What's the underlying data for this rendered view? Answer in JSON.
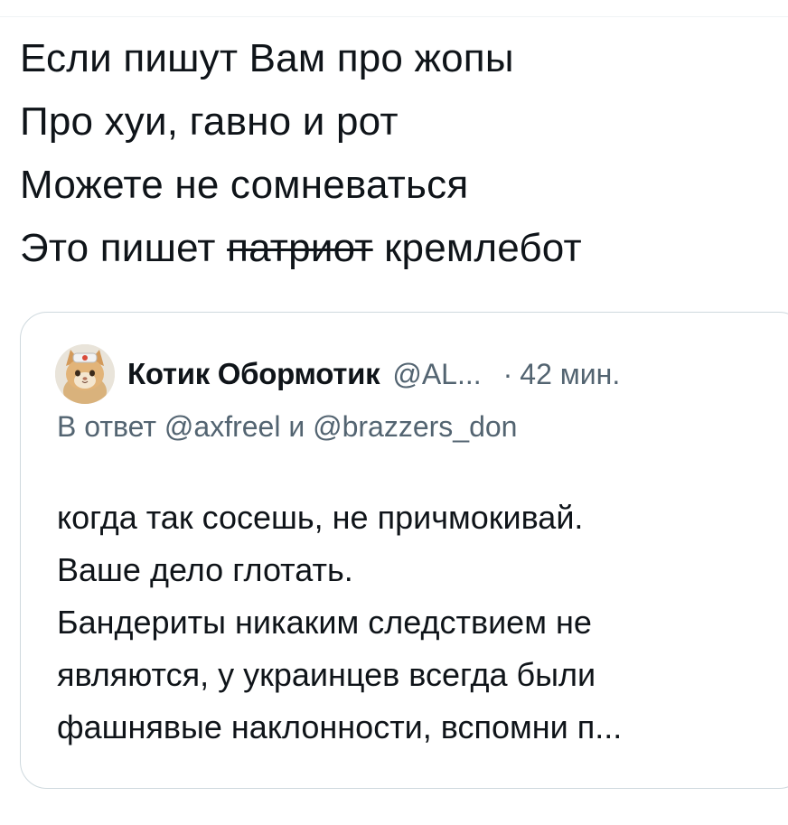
{
  "tweet": {
    "lines": [
      "Если пишут Вам про жопы",
      "Про хуи, гавно и рот",
      "Можете не сомневаться"
    ],
    "last_line_prefix": "Это пишет ",
    "last_line_struck": "патриот",
    "last_line_suffix": " кремлебот"
  },
  "quote": {
    "author_name": "Котик Обормотик",
    "author_handle": "@AL...",
    "separator": "·",
    "time": "42 мин.",
    "reply_to": "В ответ @axfreel и @brazzers_don",
    "text_lines": [
      "когда так сосешь, не причмокивай.",
      "Ваше дело глотать.",
      "Бандериты никаким следствием не",
      "являются, у украинцев всегда были",
      "фашнявые наклонности, вспомни п..."
    ],
    "avatar_icon": "cat-avatar-icon"
  }
}
